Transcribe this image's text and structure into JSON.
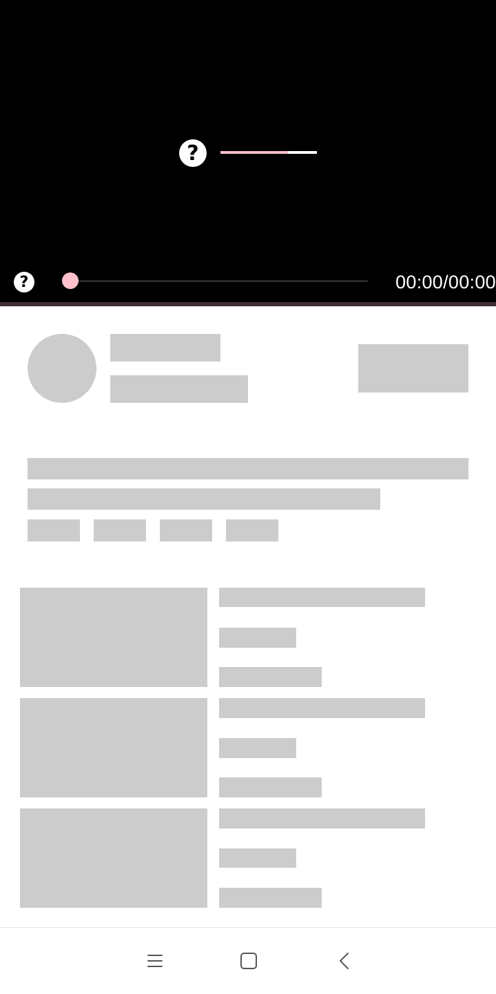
{
  "player": {
    "center_icon": "question-mark-icon",
    "control_icon": "question-mark-icon",
    "icon_glyph": "?",
    "time_display": "00:00/00:00",
    "playback_progress": 0,
    "loading_progress": 0.7
  },
  "colors": {
    "player_background": "#000000",
    "accent": "#ffc0cb",
    "skeleton": "#cccccc",
    "divider": "#3d2f35"
  },
  "navigation": {
    "menu_icon": "menu-icon",
    "home_icon": "square-home-icon",
    "back_icon": "chevron-left-back-icon"
  }
}
